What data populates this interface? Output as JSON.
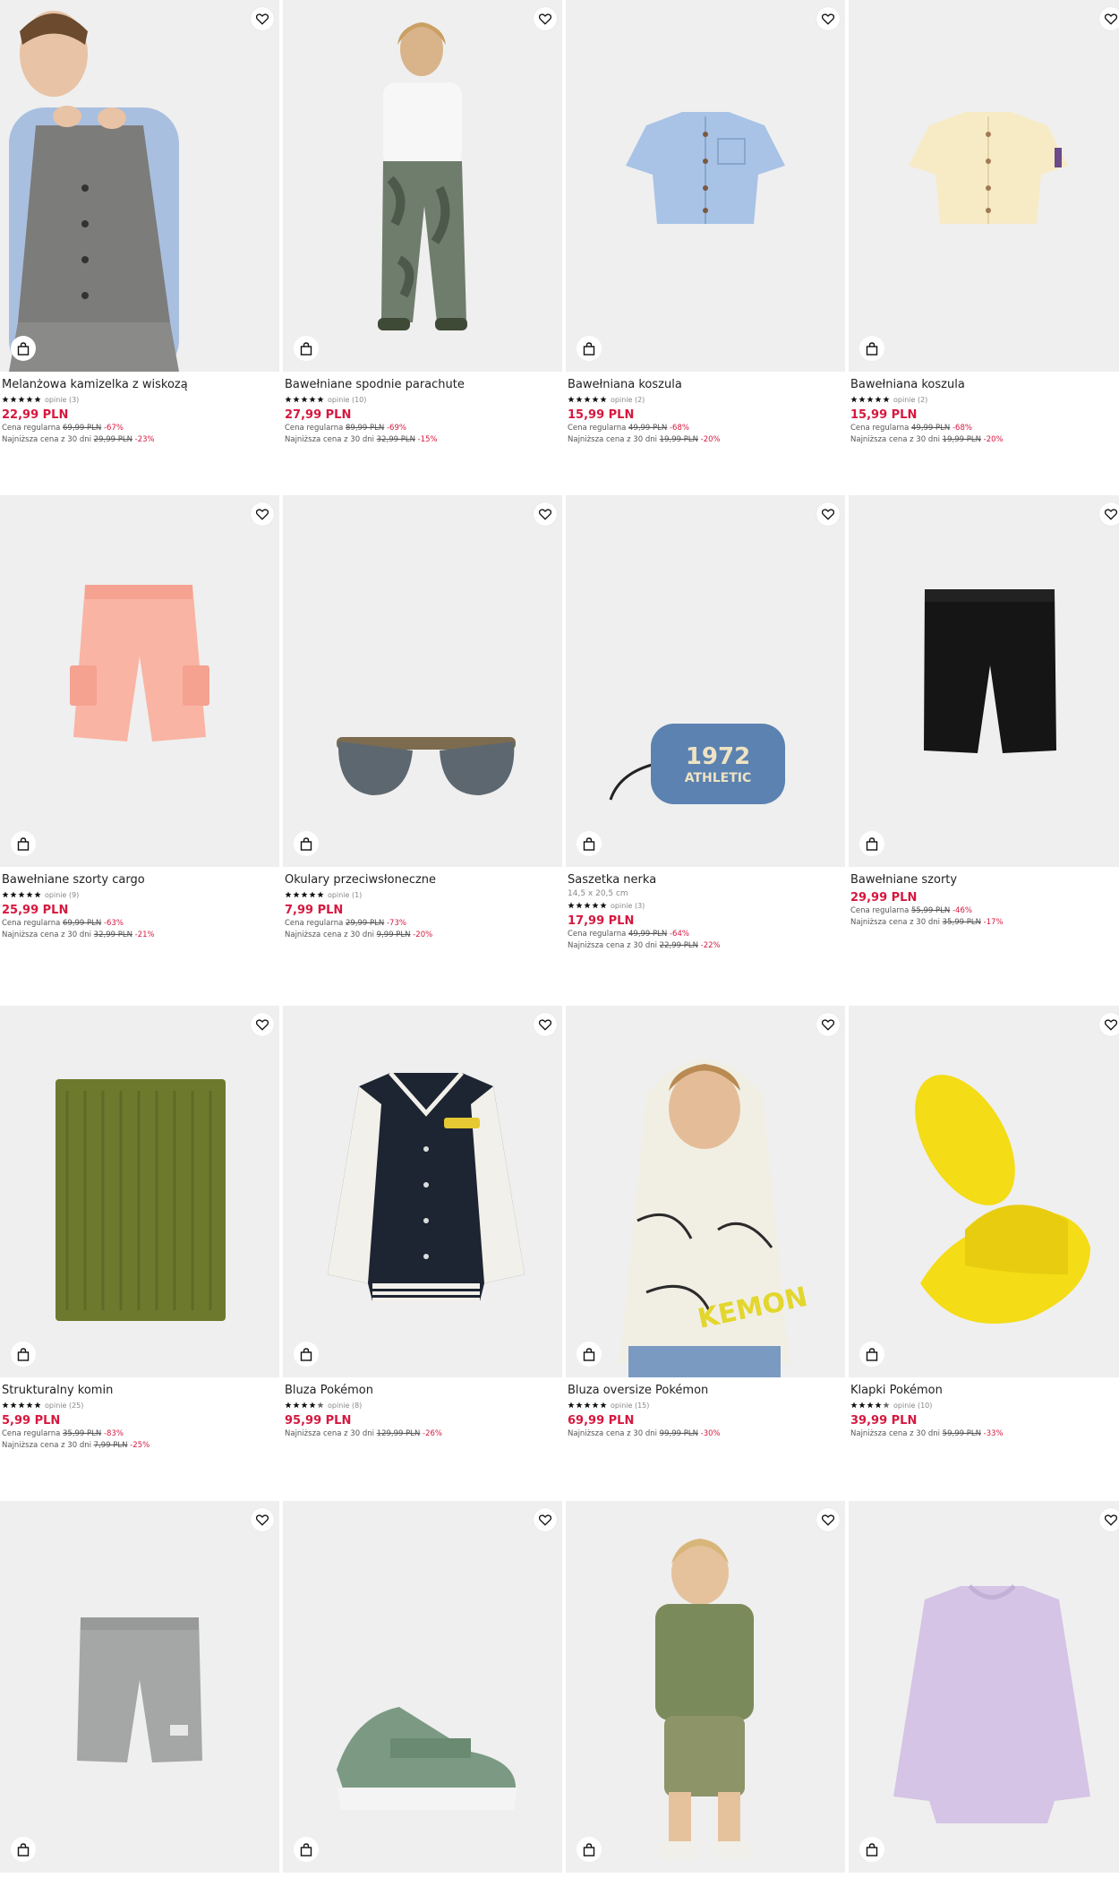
{
  "labels": {
    "regular": "Cena regularna",
    "lowest30": "Najniższa cena z 30 dni"
  },
  "colors": {
    "accent": "#d6183f",
    "tile_bg": "#efefef"
  },
  "products": [
    {
      "name": "Melanżowa kamizelka z wiskozą",
      "dims": "",
      "rating": 5,
      "opinions": "opinie (3)",
      "price": "22,99 PLN",
      "regular": "69,99 PLN",
      "regular_disc": "-67%",
      "lowest": "29,99 PLN",
      "lowest_disc": "-23%",
      "image": "boy-in-grey-vest"
    },
    {
      "name": "Bawełniane spodnie parachute",
      "dims": "",
      "rating": 5,
      "opinions": "opinie (10)",
      "price": "27,99 PLN",
      "regular": "89,99 PLN",
      "regular_disc": "-69%",
      "lowest": "32,99 PLN",
      "lowest_disc": "-15%",
      "image": "boy-in-camo-pants"
    },
    {
      "name": "Bawełniana koszula",
      "dims": "",
      "rating": 5,
      "opinions": "opinie (2)",
      "price": "15,99 PLN",
      "regular": "49,99 PLN",
      "regular_disc": "-68%",
      "lowest": "19,99 PLN",
      "lowest_disc": "-20%",
      "image": "blue-shirt"
    },
    {
      "name": "Bawełniana koszula",
      "dims": "",
      "rating": 5,
      "opinions": "opinie (2)",
      "price": "15,99 PLN",
      "regular": "49,99 PLN",
      "regular_disc": "-68%",
      "lowest": "19,99 PLN",
      "lowest_disc": "-20%",
      "image": "cream-shirt"
    },
    {
      "name": "Bawełniane szorty cargo",
      "dims": "",
      "rating": 5,
      "opinions": "opinie (9)",
      "price": "25,99 PLN",
      "regular": "69,99 PLN",
      "regular_disc": "-63%",
      "lowest": "32,99 PLN",
      "lowest_disc": "-21%",
      "image": "peach-cargo-shorts"
    },
    {
      "name": "Okulary przeciwsłoneczne",
      "dims": "",
      "rating": 5,
      "opinions": "opinie (1)",
      "price": "7,99 PLN",
      "regular": "29,99 PLN",
      "regular_disc": "-73%",
      "lowest": "9,99 PLN",
      "lowest_disc": "-20%",
      "image": "sunglasses"
    },
    {
      "name": "Saszetka nerka",
      "dims": "14,5 x 20,5 cm",
      "rating": 5,
      "opinions": "opinie (3)",
      "price": "17,99 PLN",
      "regular": "49,99 PLN",
      "regular_disc": "-64%",
      "lowest": "22,99 PLN",
      "lowest_disc": "-22%",
      "image": "blue-waist-bag",
      "bag_text1": "1972",
      "bag_text2": "ATHLETIC"
    },
    {
      "name": "Bawełniane szorty",
      "dims": "",
      "rating": 0,
      "opinions": "",
      "price": "29,99 PLN",
      "regular": "55,99 PLN",
      "regular_disc": "-46%",
      "lowest": "35,99 PLN",
      "lowest_disc": "-17%",
      "image": "black-shorts"
    },
    {
      "name": "Strukturalny komin",
      "dims": "",
      "rating": 5,
      "opinions": "opinie (25)",
      "price": "5,99 PLN",
      "regular": "35,99 PLN",
      "regular_disc": "-83%",
      "lowest": "7,99 PLN",
      "lowest_disc": "-25%",
      "image": "green-snood"
    },
    {
      "name": "Bluza Pokémon",
      "dims": "",
      "rating": 4.5,
      "opinions": "opinie (8)",
      "price": "95,99 PLN",
      "regular": "",
      "regular_disc": "",
      "lowest": "129,99 PLN",
      "lowest_disc": "-26%",
      "image": "bomber-jacket"
    },
    {
      "name": "Bluza oversize Pokémon",
      "dims": "",
      "rating": 5,
      "opinions": "opinie (15)",
      "price": "69,99 PLN",
      "regular": "",
      "regular_disc": "",
      "lowest": "99,99 PLN",
      "lowest_disc": "-30%",
      "image": "kid-in-hoodie"
    },
    {
      "name": "Klapki Pokémon",
      "dims": "",
      "rating": 4.5,
      "opinions": "opinie (10)",
      "price": "39,99 PLN",
      "regular": "",
      "regular_disc": "",
      "lowest": "59,99 PLN",
      "lowest_disc": "-33%",
      "image": "yellow-slides"
    },
    {
      "name": "",
      "dims": "",
      "rating": 0,
      "opinions": "",
      "price": "",
      "regular": "",
      "regular_disc": "",
      "lowest": "",
      "lowest_disc": "",
      "image": "grey-shorts"
    },
    {
      "name": "",
      "dims": "",
      "rating": 0,
      "opinions": "",
      "price": "",
      "regular": "",
      "regular_disc": "",
      "lowest": "",
      "lowest_disc": "",
      "image": "green-sneaker"
    },
    {
      "name": "",
      "dims": "",
      "rating": 0,
      "opinions": "",
      "price": "",
      "regular": "",
      "regular_disc": "",
      "lowest": "",
      "lowest_disc": "",
      "image": "toddler-walking"
    },
    {
      "name": "",
      "dims": "",
      "rating": 0,
      "opinions": "",
      "price": "",
      "regular": "",
      "regular_disc": "",
      "lowest": "",
      "lowest_disc": "",
      "image": "lilac-sweater"
    }
  ]
}
